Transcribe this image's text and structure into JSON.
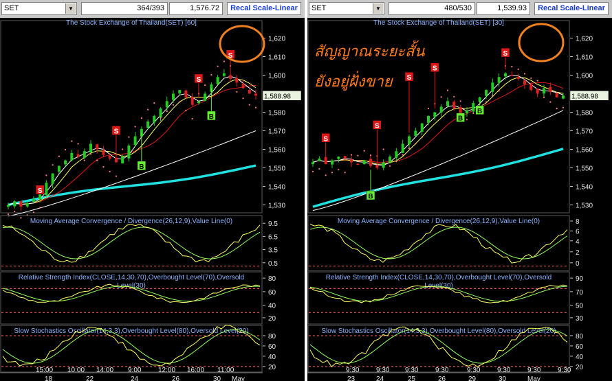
{
  "left": {
    "symbol": "SET",
    "counter": "364/393",
    "value": "1,576.72",
    "recal_label": "Recal Scale-Linear",
    "price_title": "The Stock Exchange of Thailand(SET) [60]",
    "price_ticks": [
      "1,620",
      "1,610",
      "1,600",
      "1,590",
      "1,580",
      "1,570",
      "1,560",
      "1,550",
      "1,540",
      "1,530"
    ],
    "last_price": "1,588.98",
    "macd_title": "Moving Average Convergence / Divergence(26,12,9),Value Line(0)",
    "macd_ticks": [
      "9.5",
      "6.5",
      "3.5",
      "0.5"
    ],
    "rsi_title_1": "Relative Strength Index(CLOSE,14,30,70),Overbought Level(70),Oversold",
    "rsi_title_2": "Level(30)",
    "rsi_ticks": [
      "80",
      "60",
      "40",
      "20"
    ],
    "stoch_title": "Slow Stochastics Oscillator(14,3,3),Overbought Level(80),Oversold Level(20)",
    "stoch_ticks": [
      "80",
      "60",
      "40",
      "20"
    ],
    "time_labels": [
      "15:00",
      "10:00",
      "14:00",
      "9:00",
      "12:00",
      "16:00",
      "11:00"
    ],
    "date_labels": [
      "18",
      "22",
      "24",
      "26",
      "30",
      "May"
    ]
  },
  "right": {
    "symbol": "SET",
    "counter": "480/530",
    "value": "1,539.93",
    "recal_label": "Recal Scale-Linear",
    "price_title": "The Stock Exchange of Thailand(SET) [30]",
    "price_ticks": [
      "1,620",
      "1,610",
      "1,600",
      "1,590",
      "1,580",
      "1,570",
      "1,560",
      "1,550",
      "1,540",
      "1,530"
    ],
    "last_price": "1,588.98",
    "thai_line_1": "สัญญาณระยะสั้น",
    "thai_line_2": "ยังอยู่ฝั่งขาย",
    "macd_title": "Moving Average Convergence / Divergence(26,12,9),Value Line(0)",
    "macd_ticks": [
      "8",
      "6",
      "4",
      "2",
      "0"
    ],
    "rsi_title_1": "Relative Strength Index(CLOSE,14,30,70),Overbought Level(70),Oversold",
    "rsi_title_2": "Level(30)",
    "rsi_ticks": [
      "90",
      "70",
      "50",
      "30"
    ],
    "stoch_title": "Slow Stochastics Oscillator(14,3,3),Overbought Level(80),Oversold Level(20)",
    "stoch_ticks": [
      "80",
      "60",
      "40",
      "20"
    ],
    "time_labels": [
      "9:30",
      "9:30",
      "9:30",
      "9:30",
      "9:30",
      "9:30",
      "9:30",
      "9:30"
    ],
    "date_labels": [
      "23",
      "24",
      "25",
      "26",
      "29",
      "30",
      "May"
    ]
  },
  "colors": {
    "up": "#22cc22",
    "down": "#dd2020",
    "sar": "#ff8080",
    "ma_long": "#20e0e0",
    "ma_mid": "#ffffff",
    "ma_fast": "#ffff66",
    "signal_sell": "#e01818",
    "signal_buy": "#66ee33",
    "title_text": "#8ab4ff",
    "osc_main": "#ffff66",
    "highlight_circle": "#f08020"
  },
  "chart_data": [
    {
      "type": "line",
      "title": "The Stock Exchange of Thailand(SET) [60]",
      "ylim": [
        1525,
        1625
      ],
      "last_price": 1588.98,
      "close": [
        1530,
        1532,
        1529,
        1531,
        1533,
        1536,
        1542,
        1547,
        1551,
        1554,
        1558,
        1556,
        1559,
        1563,
        1560,
        1557,
        1555,
        1553,
        1556,
        1562,
        1567,
        1571,
        1575,
        1578,
        1582,
        1586,
        1590,
        1592,
        1588,
        1584,
        1586,
        1590,
        1595,
        1599,
        1601,
        1598,
        1596,
        1593,
        1590,
        1589
      ],
      "signals": [
        {
          "label": "S",
          "kind": "sell",
          "price": 1538
        },
        {
          "label": "S",
          "kind": "sell",
          "price": 1570
        },
        {
          "label": "B",
          "kind": "buy",
          "price": 1551
        },
        {
          "label": "S",
          "kind": "sell",
          "price": 1598
        },
        {
          "label": "S",
          "kind": "sell",
          "price": 1611
        },
        {
          "label": "B",
          "kind": "buy",
          "price": 1578
        }
      ]
    },
    {
      "type": "line",
      "title": "The Stock Exchange of Thailand(SET) [30]",
      "ylim": [
        1525,
        1625
      ],
      "last_price": 1588.98,
      "close": [
        1553,
        1555,
        1552,
        1554,
        1556,
        1555,
        1553,
        1552,
        1554,
        1551,
        1550,
        1553,
        1556,
        1559,
        1563,
        1567,
        1570,
        1574,
        1578,
        1580,
        1583,
        1586,
        1582,
        1579,
        1581,
        1585,
        1588,
        1592,
        1596,
        1599,
        1601,
        1600,
        1598,
        1595,
        1592,
        1590,
        1593,
        1591,
        1588,
        1589
      ],
      "signals": [
        {
          "label": "S",
          "kind": "sell",
          "price": 1566
        },
        {
          "label": "B",
          "kind": "buy",
          "price": 1535
        },
        {
          "label": "S",
          "kind": "sell",
          "price": 1573
        },
        {
          "label": "S",
          "kind": "sell",
          "price": 1599
        },
        {
          "label": "S",
          "kind": "sell",
          "price": 1604
        },
        {
          "label": "B",
          "kind": "buy",
          "price": 1577
        },
        {
          "label": "B",
          "kind": "buy",
          "price": 1581
        },
        {
          "label": "S",
          "kind": "sell",
          "price": 1612
        }
      ]
    }
  ]
}
